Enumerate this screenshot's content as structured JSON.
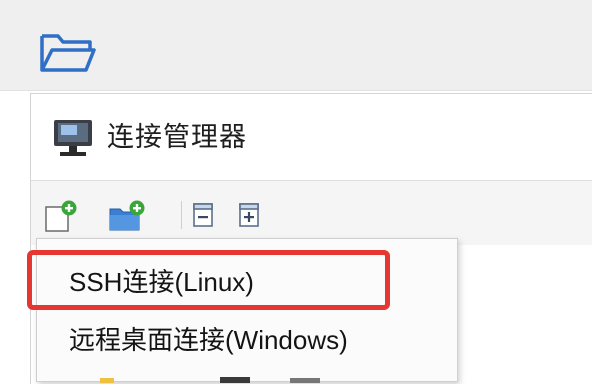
{
  "topbar": {
    "icon": "folder-open-icon"
  },
  "panel": {
    "icon": "computer-monitor-icon",
    "title": "连接管理器",
    "toolbar": {
      "buttons": [
        {
          "icon": "new-connection-icon"
        },
        {
          "icon": "new-folder-icon"
        },
        {
          "icon": "collapse-all-icon"
        },
        {
          "icon": "expand-all-icon"
        }
      ]
    }
  },
  "menu": {
    "items": [
      {
        "label": "SSH连接(Linux)",
        "highlighted": true
      },
      {
        "label": "远程桌面连接(Windows)",
        "highlighted": false
      }
    ]
  },
  "colors": {
    "accent_blue": "#2f6fc6",
    "highlight_red": "#e53632",
    "plus_green": "#3aa63a"
  }
}
